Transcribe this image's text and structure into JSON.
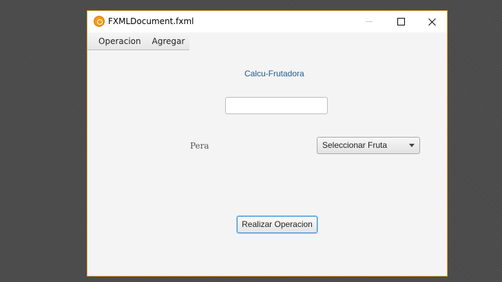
{
  "window": {
    "title": "FXMLDocument.fxml"
  },
  "menubar": {
    "items": [
      {
        "label": "Operacion"
      },
      {
        "label": "Agregar"
      }
    ]
  },
  "content": {
    "title": "Calcu-Frutadora",
    "input": {
      "value": "",
      "placeholder": ""
    },
    "fruit_label": "Pera",
    "select": {
      "selected": "Seleccionar Fruta"
    },
    "action_button": "Realizar Operacion"
  },
  "colors": {
    "window_border": "#e8a33a",
    "title_text": "#1f5a8c",
    "focus_border": "#3a8fd2"
  }
}
